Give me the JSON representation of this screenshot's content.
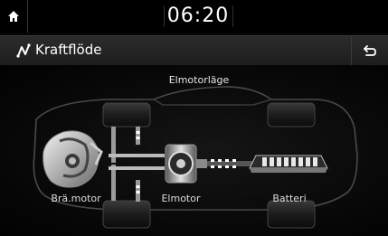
{
  "status_bar": {
    "time": "06:20",
    "home_icon": "home-icon"
  },
  "header": {
    "title": "Kraftflöde",
    "title_icon": "power-flow-icon",
    "back_icon": "back-arrow-icon"
  },
  "diagram": {
    "mode_label": "Elmotorläge",
    "components": {
      "engine": "Brä.motor",
      "motor": "Elmotor",
      "battery": "Batteri"
    },
    "active_flow": "battery-to-motor-to-wheels",
    "colors": {
      "accent": "#ffffff",
      "frame": "#5a5a5a",
      "battery_cells": "#e8e8e8"
    }
  }
}
